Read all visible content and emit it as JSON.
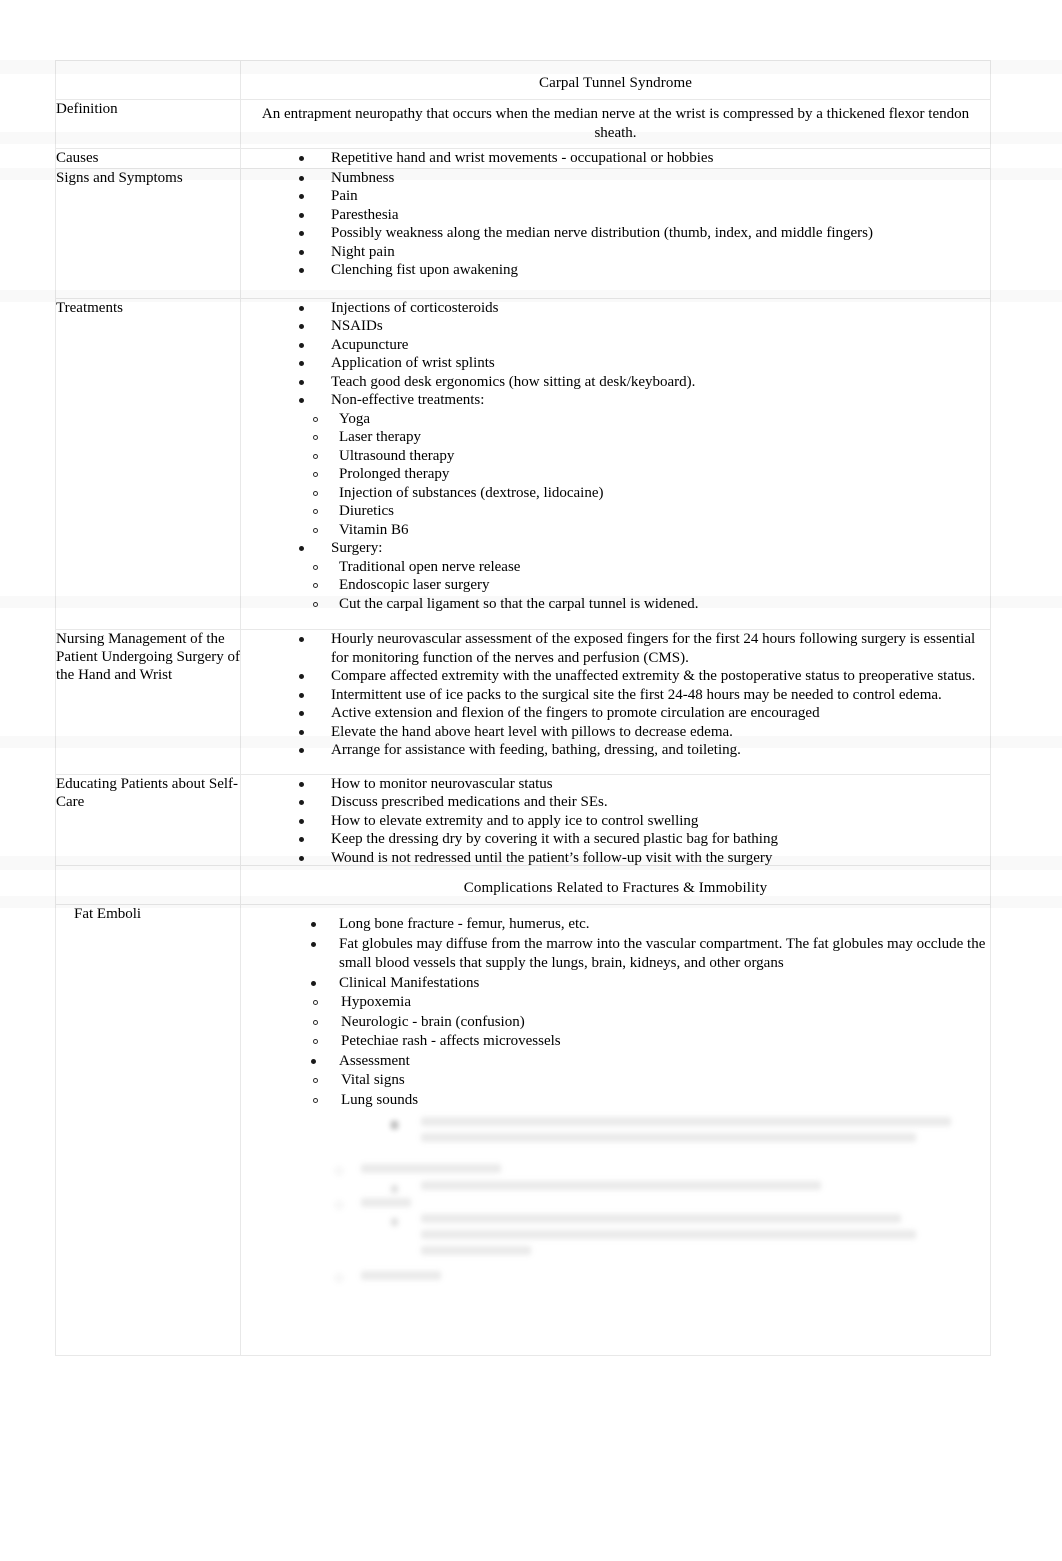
{
  "document": {
    "title": "Carpal Tunnel Syndrome Study Notes",
    "background_color": "#ffffff",
    "text_color": "#000000",
    "table_border_color": "#e8e8e8"
  },
  "tables": [
    {
      "id": "carpal-tunnel-syndrome",
      "header": {
        "label_blank": "",
        "title": "Carpal Tunnel Syndrome"
      },
      "rows": [
        {
          "label": "Definition",
          "content_type": "paragraph",
          "paragraph": "An entrapment neuropathy that occurs when the median nerve at the wrist is compressed by a thickened flexor tendon sheath."
        },
        {
          "label": "Causes",
          "content_type": "list",
          "items": [
            {
              "level": 1,
              "text": "Repetitive hand and wrist movements - occupational or hobbies"
            }
          ]
        },
        {
          "label": "Signs and Symptoms",
          "content_type": "list",
          "items": [
            {
              "level": 1,
              "text": "Numbness"
            },
            {
              "level": 1,
              "text": "Pain"
            },
            {
              "level": 1,
              "text": "Paresthesia"
            },
            {
              "level": 1,
              "text": "Possibly weakness along the median nerve distribution (thumb, index, and middle fingers)"
            },
            {
              "level": 1,
              "text": "Night pain"
            },
            {
              "level": 1,
              "text": "Clenching fist upon awakening"
            }
          ]
        },
        {
          "label": "Treatments",
          "content_type": "list",
          "items": [
            {
              "level": 1,
              "text": "Injections of corticosteroids"
            },
            {
              "level": 1,
              "text": "NSAIDs"
            },
            {
              "level": 1,
              "text": "Acupuncture"
            },
            {
              "level": 1,
              "text": "Application of wrist splints"
            },
            {
              "level": 1,
              "text": "Teach good desk ergonomics (how sitting at desk/keyboard)."
            },
            {
              "level": 1,
              "text": "Non-effective treatments:"
            },
            {
              "level": 2,
              "text": "Yoga"
            },
            {
              "level": 2,
              "text": "Laser therapy"
            },
            {
              "level": 2,
              "text": "Ultrasound therapy"
            },
            {
              "level": 2,
              "text": "Prolonged therapy"
            },
            {
              "level": 2,
              "text": "Injection of substances (dextrose, lidocaine)"
            },
            {
              "level": 2,
              "text": "Diuretics"
            },
            {
              "level": 2,
              "text": "Vitamin B6"
            },
            {
              "level": 1,
              "text": "Surgery:"
            },
            {
              "level": 2,
              "text": "Traditional open nerve release"
            },
            {
              "level": 2,
              "text": "Endoscopic laser surgery"
            },
            {
              "level": 2,
              "text": "Cut the carpal ligament so that the carpal tunnel is widened."
            }
          ]
        },
        {
          "label": "Nursing Management of the Patient Undergoing Surgery of the Hand and Wrist",
          "content_type": "list",
          "items": [
            {
              "level": 1,
              "text": "Hourly neurovascular assessment of the exposed fingers for the first 24 hours following surgery is essential for monitoring function of the nerves and perfusion (CMS)."
            },
            {
              "level": 1,
              "text": "Compare affected extremity with the unaffected extremity & the postoperative status to preoperative status."
            },
            {
              "level": 1,
              "text": "Intermittent use of ice packs to the surgical site the first 24-48 hours may be needed to control edema."
            },
            {
              "level": 1,
              "text": "Active extension and flexion of the fingers to promote circulation are encouraged"
            },
            {
              "level": 1,
              "text": "Elevate the hand above heart level with pillows to decrease edema."
            },
            {
              "level": 1,
              "text": "Arrange for assistance with feeding, bathing, dressing, and toileting."
            }
          ]
        },
        {
          "label": "Educating Patients about Self-Care",
          "content_type": "list",
          "items": [
            {
              "level": 1,
              "text": "How to monitor neurovascular status"
            },
            {
              "level": 1,
              "text": "Discuss prescribed medications and their SEs."
            },
            {
              "level": 1,
              "text": "How to elevate extremity and to apply ice to control swelling"
            },
            {
              "level": 1,
              "text": "Keep the dressing dry by covering it with a secured plastic bag for bathing"
            },
            {
              "level": 1,
              "text": "Wound is not redressed until the patient’s follow-up visit with the surgery"
            }
          ]
        }
      ]
    },
    {
      "id": "complications-fractures-immobility",
      "header": {
        "label_blank": "",
        "title": "Complications Related to Fractures & Immobility"
      },
      "rows": [
        {
          "label": "Fat Emboli",
          "label_indented": true,
          "content_type": "list",
          "items": [
            {
              "level": 1,
              "text": "Long bone fracture - femur, humerus, etc."
            },
            {
              "level": 1,
              "text": "Fat globules may diffuse from the marrow into the vascular compartment. The fat globules may occlude the small blood vessels that supply the lungs, brain, kidneys, and other organs"
            },
            {
              "level": 1,
              "text": "Clinical Manifestations"
            },
            {
              "level": 2,
              "text": "Hypoxemia"
            },
            {
              "level": 2,
              "text": "Neurologic - brain (confusion)"
            },
            {
              "level": 2,
              "text": "Petechiae rash - affects microvessels"
            },
            {
              "level": 1,
              "text": "Assessment"
            },
            {
              "level": 2,
              "text": "Vital signs"
            },
            {
              "level": 2,
              "text": "Lung sounds"
            }
          ],
          "faded_region": {
            "note": "remaining content is faded/blurred and illegible in the screenshot",
            "blurred_blocks": [
              {
                "marker": "square",
                "indent": 150,
                "lines": [
                  560,
                  520
                ]
              },
              {
                "marker": "circle",
                "indent": 86,
                "lines": [
                  150
                ]
              },
              {
                "marker": "square",
                "indent": 150,
                "lines": [
                  420
                ]
              },
              {
                "marker": "circle",
                "indent": 86,
                "lines": [
                  60
                ]
              },
              {
                "marker": "square",
                "indent": 150,
                "lines": [
                  500,
                  500,
                  120
                ]
              },
              {
                "marker": "circle",
                "indent": 86,
                "lines": [
                  80
                ]
              }
            ]
          }
        }
      ]
    }
  ]
}
